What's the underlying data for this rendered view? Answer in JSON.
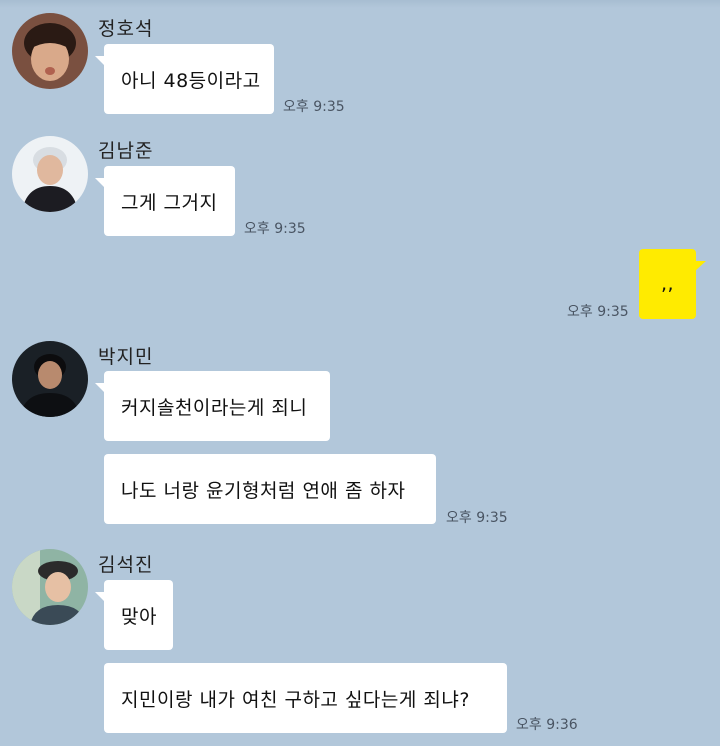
{
  "colors": {
    "background": "#b2c7da",
    "bubble_other": "#ffffff",
    "bubble_me": "#ffeb00"
  },
  "messages": [
    {
      "sender": "정호석",
      "text": "아니 48등이라고",
      "time": "오후 9:35"
    },
    {
      "sender": "김남준",
      "text": "그게 그거지",
      "time": "오후 9:35"
    },
    {
      "sender": "me",
      "text": ",,",
      "time": "오후 9:35"
    },
    {
      "sender": "박지민",
      "texts": [
        "커지솔천이라는게 죄니",
        "나도 너랑 윤기형처럼 연애 좀 하자"
      ],
      "time": "오후 9:35"
    },
    {
      "sender": "김석진",
      "texts": [
        "맞아",
        "지민이랑 내가 여친 구하고 싶다는게 죄냐?"
      ],
      "time": "오후 9:36"
    }
  ]
}
